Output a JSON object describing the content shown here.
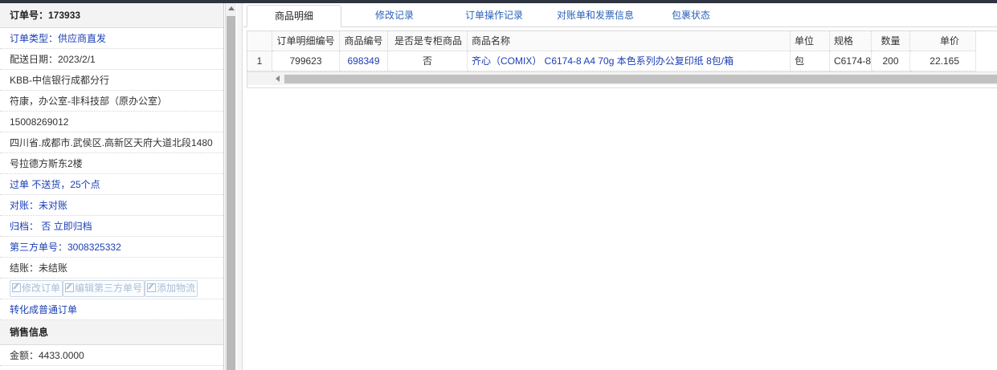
{
  "left_panel": {
    "order_no": "订单号：173933",
    "order_type": "订单类型：供应商直发",
    "delivery_date": "配送日期：2023/2/1",
    "company": "KBB-中信银行成都分行",
    "contact": "符康，办公室-非科技部（原办公室）",
    "phone": "15008269012",
    "address_line1": "四川省.成都市.武侯区.高新区天府大道北段1480",
    "address_line2": "号拉德方斯东2楼",
    "pass_info": "过单 不送货，25个点",
    "reconcile": "对账：未对账",
    "archive": "归档： 否 立即归档",
    "third_party_no": "第三方单号：3008325332",
    "settle": "结账：未结账",
    "btn_modify_order": "修改订单",
    "btn_edit_third": "编辑第三方单号",
    "btn_add_logistics": "添加物流",
    "convert_link": "转化成普通订单",
    "sales_section": "销售信息",
    "amount": "金额：4433.0000"
  },
  "tabs": [
    "商品明细",
    "修改记录",
    "订单操作记录",
    "对账单和发票信息",
    "包裹状态"
  ],
  "table": {
    "headers": [
      "",
      "订单明细编号",
      "商品编号",
      "是否是专柜商品",
      "商品名称",
      "单位",
      "规格",
      "数量",
      "单价"
    ],
    "rows": [
      [
        "1",
        "799623",
        "698349",
        "否",
        "齐心（COMIX） C6174-8 A4 70g 本色系列办公复印纸 8包/箱",
        "包",
        "C6174-8",
        "200",
        "22.165"
      ]
    ]
  },
  "colors": {
    "link_blue": "#1a3fb5",
    "tab_blue": "#2a62b8",
    "disabled_button": "#a9bfd6"
  }
}
